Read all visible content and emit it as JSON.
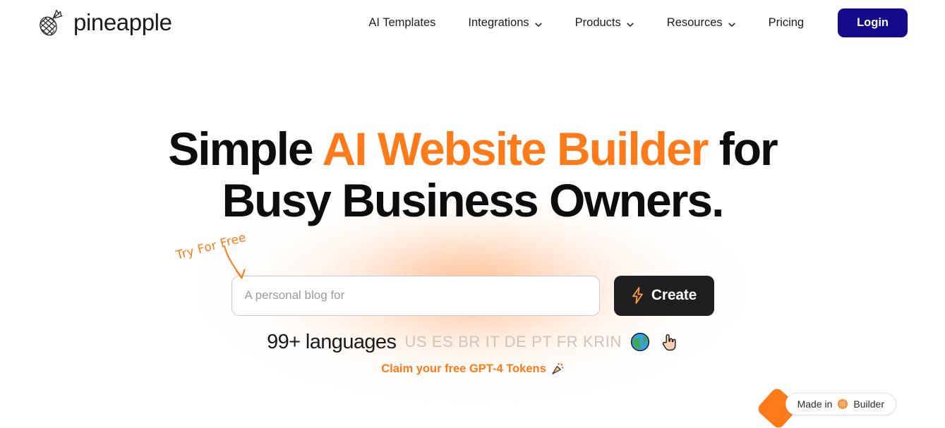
{
  "brand": {
    "name": "pineapple",
    "logo_icon": "pineapple-icon"
  },
  "nav": {
    "items": [
      {
        "label": "AI Templates",
        "has_caret": false
      },
      {
        "label": "Integrations",
        "has_caret": true
      },
      {
        "label": "Products",
        "has_caret": true
      },
      {
        "label": "Resources",
        "has_caret": true
      },
      {
        "label": "Pricing",
        "has_caret": false
      }
    ],
    "login_label": "Login",
    "login_color": "#140a8c",
    "caret_icon": "chevron-down-icon"
  },
  "hero": {
    "headline_part1": "Simple ",
    "headline_accent": "AI Website Builder",
    "headline_part2": " for",
    "headline_line2": "Busy Business Owners.",
    "accent_color": "#ff7a18",
    "annotation": {
      "text": "Try For Free",
      "color": "#ff7a18",
      "arrow_icon": "curved-arrow-down-icon"
    },
    "form": {
      "input_placeholder": "A personal blog for",
      "input_value": "",
      "create_label": "Create",
      "create_icon": "lightning-bolt-icon",
      "create_bg": "#1f1f21"
    },
    "languages": {
      "count_label": "99+ languages",
      "codes": "US ES BR IT DE PT FR KRIN",
      "globe_icon": "globe-icon",
      "hand_icon": "pointing-hand-up-icon"
    },
    "tokens": {
      "label": "Claim your free GPT-4 Tokens",
      "icon": "party-popper-icon",
      "color": "#ff7a18"
    }
  },
  "badge": {
    "prefix": "Made in",
    "suffix": "Builder",
    "icon": "pineapple-badge-icon",
    "accent": "#ff7a18"
  }
}
